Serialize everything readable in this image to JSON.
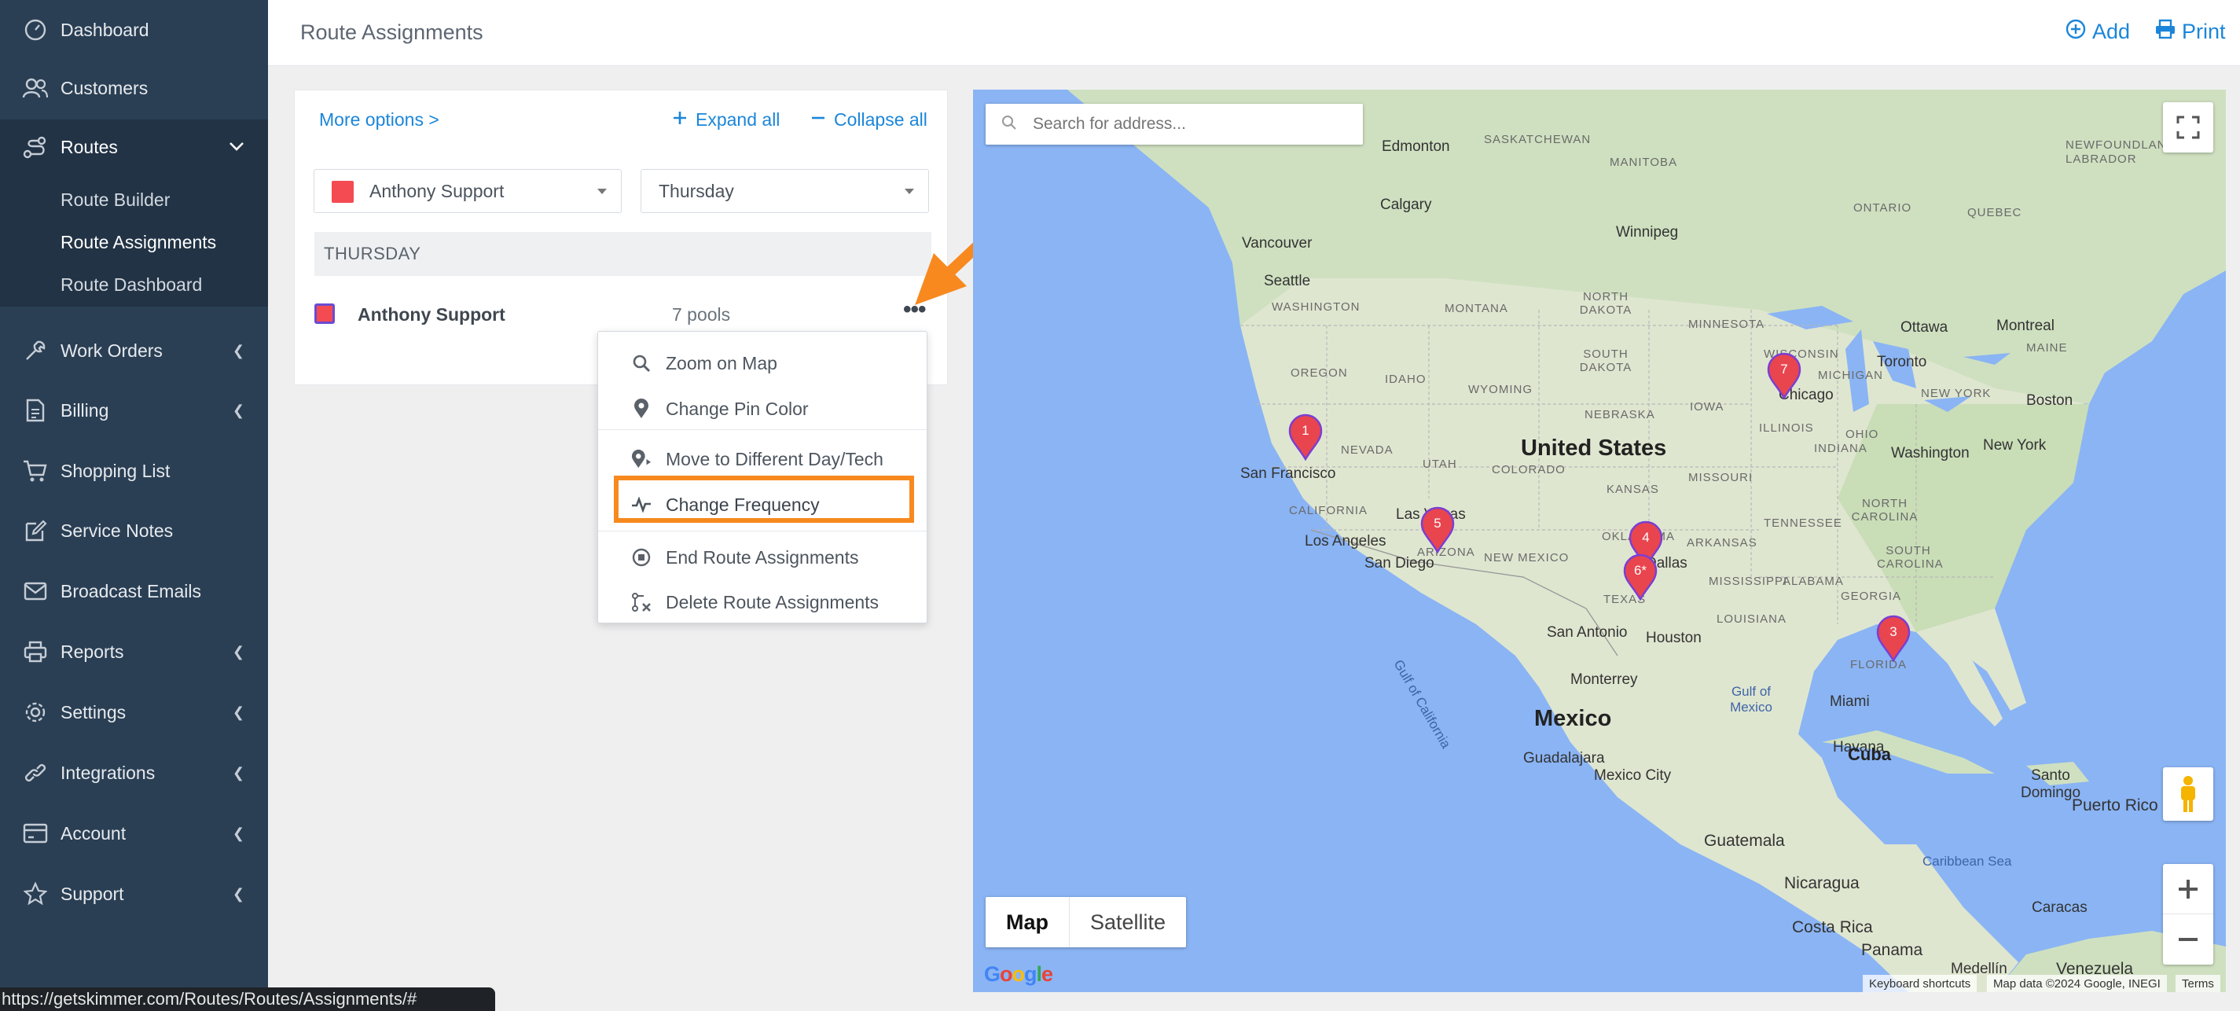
{
  "sidebar": {
    "items": [
      {
        "label": "Dashboard",
        "icon": "dashboard-icon"
      },
      {
        "label": "Customers",
        "icon": "customers-icon"
      },
      {
        "label": "Routes",
        "icon": "routes-icon"
      },
      {
        "label": "Work Orders",
        "icon": "work-orders-icon"
      },
      {
        "label": "Billing",
        "icon": "billing-icon"
      },
      {
        "label": "Shopping List",
        "icon": "shopping-cart-icon"
      },
      {
        "label": "Service Notes",
        "icon": "service-notes-icon"
      },
      {
        "label": "Broadcast Emails",
        "icon": "envelope-icon"
      },
      {
        "label": "Reports",
        "icon": "printer-icon"
      },
      {
        "label": "Settings",
        "icon": "gear-icon"
      },
      {
        "label": "Integrations",
        "icon": "link-icon"
      },
      {
        "label": "Account",
        "icon": "account-card-icon"
      },
      {
        "label": "Support",
        "icon": "star-icon"
      }
    ],
    "routes_sub": [
      "Route Builder",
      "Route Assignments",
      "Route Dashboard"
    ]
  },
  "header": {
    "title": "Route Assignments",
    "add_label": "Add",
    "print_label": "Print"
  },
  "panel": {
    "more_options": "More options >",
    "expand_all": "Expand all",
    "collapse_all": "Collapse all",
    "tech_select": "Anthony Support",
    "day_select": "Thursday",
    "day_heading": "THURSDAY",
    "route_name": "Anthony Support",
    "route_count": "7 pools",
    "swatch_color": "#f44b52"
  },
  "menu": {
    "items": [
      "Zoom on Map",
      "Change Pin Color",
      "Move to Different Day/Tech",
      "Change Frequency",
      "End Route Assignments",
      "Delete Route Assignments"
    ],
    "highlight_color": "#f7891f"
  },
  "map": {
    "search_placeholder": "Search for address...",
    "type_map": "Map",
    "type_satellite": "Satellite",
    "country_label": "United States",
    "mexico_label": "Mexico",
    "cuba_label": "Cuba",
    "pins": [
      "1",
      "5",
      "4",
      "6*",
      "7",
      "3"
    ],
    "pin_color": "#e9454e",
    "labels": {
      "edmonton": "Edmonton",
      "saskatchewan": "SASKATCHEWAN",
      "manitoba": "MANITOBA",
      "calgary": "Calgary",
      "ontario": "ONTARIO",
      "quebec": "QUEBEC",
      "newfoundland": "NEWFOUNDLAND AND LABRADOR",
      "winnipeg": "Winnipeg",
      "vancouver": "Vancouver",
      "seattle": "Seattle",
      "washington": "WASHINGTON",
      "montana": "MONTANA",
      "north_dakota": "NORTH DAKOTA",
      "minnesota": "MINNESOTA",
      "ottawa": "Ottawa",
      "montreal": "Montreal",
      "maine": "MAINE",
      "oregon": "OREGON",
      "idaho": "IDAHO",
      "south_dakota": "SOUTH DAKOTA",
      "wisconsin": "WISCONSIN",
      "toronto": "Toronto",
      "michigan": "MICHIGAN",
      "wyoming": "WYOMING",
      "chicago": "Chicago",
      "boston": "Boston",
      "new_york_state": "NEW YORK",
      "iowa": "IOWA",
      "nebraska": "NEBRASKA",
      "nevada": "NEVADA",
      "san_francisco": "San Francisco",
      "utah": "UTAH",
      "colorado": "COLORADO",
      "illinois": "ILLINOIS",
      "indiana": "INDIANA",
      "ohio": "OHIO",
      "new_york": "New York",
      "washington_dc": "Washington",
      "california": "CALIFORNIA",
      "kansas": "KANSAS",
      "missouri": "MISSOURI",
      "las_vegas": "Las Vegas",
      "tennessee": "TENNESSEE",
      "los_angeles": "Los Angeles",
      "north_carolina": "NORTH CAROLINA",
      "arizona": "ARIZONA",
      "new_mexico": "NEW MEXICO",
      "oklahoma": "OKLAHOMA",
      "arkansas": "ARKANSAS",
      "south_carolina": "SOUTH CAROLINA",
      "san_diego": "San Diego",
      "dallas": "Dallas",
      "mississippi": "MISSISSIPPI",
      "alabama": "ALABAMA",
      "georgia": "GEORGIA",
      "texas": "TEXAS",
      "san_antonio": "San Antonio",
      "houston": "Houston",
      "louisiana": "LOUISIANA",
      "florida": "FLORIDA",
      "gulf_of_california": "Gulf of California",
      "monterrey": "Monterrey",
      "gulf_of_mexico": "Gulf of Mexico",
      "miami": "Miami",
      "havana": "Havana",
      "guadalajara": "Guadalajara",
      "mexico_city": "Mexico City",
      "santo_domingo": "Santo Domingo",
      "puerto_rico": "Puerto Rico",
      "guatemala": "Guatemala",
      "caribbean_sea": "Caribbean Sea",
      "nicaragua": "Nicaragua",
      "caracas": "Caracas",
      "costa_rica": "Costa Rica",
      "panama": "Panama",
      "venezuela": "Venezuela",
      "medellin": "Medellín"
    },
    "footer_keyboard": "Keyboard shortcuts",
    "footer_data": "Map data ©2024 Google, INEGI",
    "footer_terms": "Terms",
    "google_logo": "Google"
  },
  "statusbar": "https://getskimmer.com/Routes/Routes/Assignments/#"
}
